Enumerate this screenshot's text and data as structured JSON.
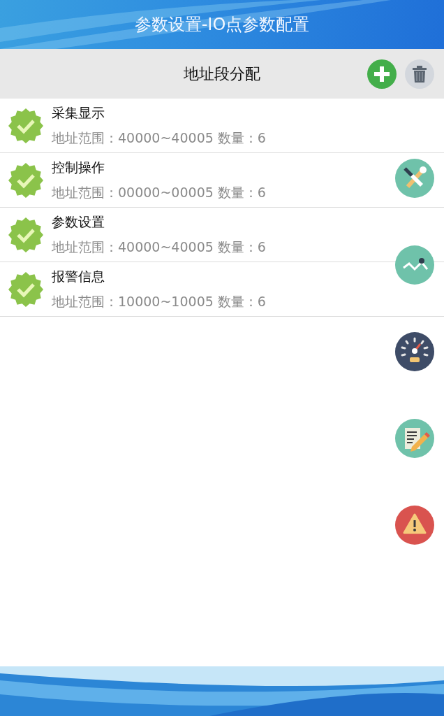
{
  "window": {
    "title": "参数设置-IO点参数配置"
  },
  "toolbar": {
    "title": "地址段分配"
  },
  "segments": [
    {
      "name": "采集显示",
      "range": "地址范围：40000~40005 数量：6",
      "checked": true
    },
    {
      "name": "控制操作",
      "range": "地址范围：00000~00005 数量：6",
      "checked": true
    },
    {
      "name": "参数设置",
      "range": "地址范围：40000~40005 数量：6",
      "checked": true
    },
    {
      "name": "报警信息",
      "range": "地址范围：10000~10005 数量：6",
      "checked": true
    }
  ],
  "side_buttons": [
    {
      "kind": "tools"
    },
    {
      "kind": "trend"
    },
    {
      "kind": "gauge"
    },
    {
      "kind": "edit"
    },
    {
      "kind": "alert"
    }
  ]
}
